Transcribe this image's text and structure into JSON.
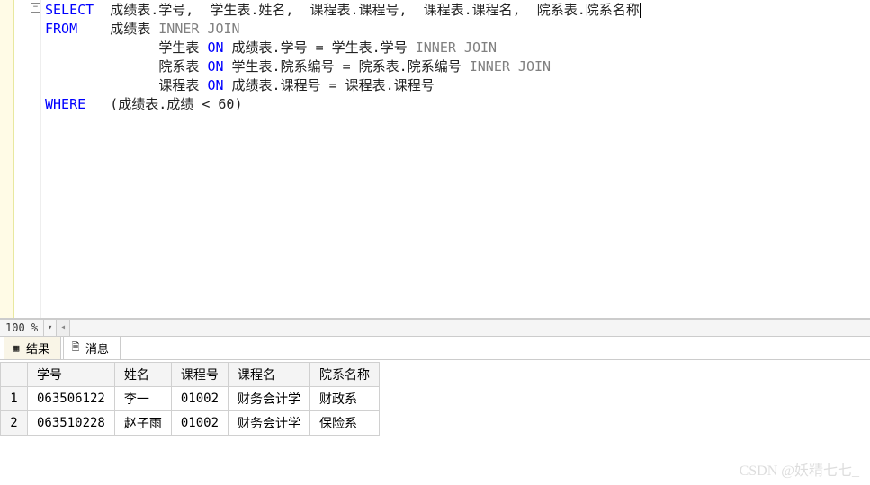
{
  "code": {
    "line1_kw": "SELECT",
    "line1_rest": "  成绩表.学号,  学生表.姓名,  课程表.课程号,  课程表.课程名,  院系表.院系名称",
    "line2_kw": "FROM",
    "line2_rest": "    成绩表 ",
    "line2_join": "INNER JOIN",
    "line3_rest": "              学生表 ",
    "line3_on": "ON",
    "line3_cond": " 成绩表.学号 = 学生表.学号 ",
    "line3_join": "INNER JOIN",
    "line4_rest": "              院系表 ",
    "line4_on": "ON",
    "line4_cond": " 学生表.院系编号 = 院系表.院系编号 ",
    "line4_join": "INNER JOIN",
    "line5_rest": "              课程表 ",
    "line5_on": "ON",
    "line5_cond": " 成绩表.课程号 = 课程表.课程号",
    "line6_kw": "WHERE",
    "line6_rest": "   (成绩表.成绩 < 60)"
  },
  "zoom": {
    "level": "100 %"
  },
  "tabs": {
    "results": "结果",
    "messages": "消息"
  },
  "grid": {
    "headers": {
      "c1": "学号",
      "c2": "姓名",
      "c3": "课程号",
      "c4": "课程名",
      "c5": "院系名称"
    },
    "rows": [
      {
        "n": "1",
        "c1": "063506122",
        "c2": "李一",
        "c3": "01002",
        "c4": "财务会计学",
        "c5": "财政系"
      },
      {
        "n": "2",
        "c1": "063510228",
        "c2": "赵子雨",
        "c3": "01002",
        "c4": "财务会计学",
        "c5": "保险系"
      }
    ]
  },
  "watermark": "CSDN @妖精七七_"
}
